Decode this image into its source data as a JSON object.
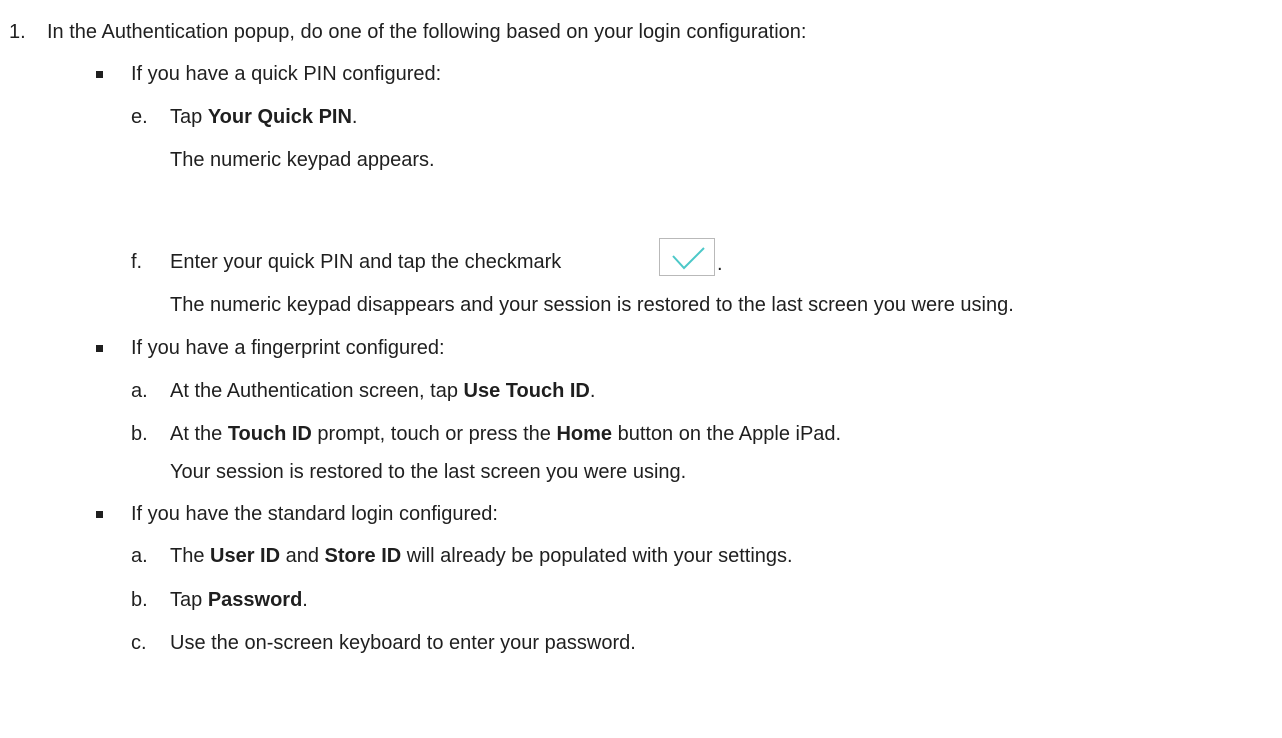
{
  "step": {
    "number": "1.",
    "text": "In the Authentication popup, do one of the following based on your login configuration:"
  },
  "quick_pin": {
    "heading": "If you have a quick PIN configured:",
    "e": {
      "marker": "e.",
      "pre": "Tap ",
      "bold": "Your Quick PIN",
      "post": ".",
      "result": "The numeric keypad appears."
    },
    "f": {
      "marker": "f.",
      "text": "Enter your quick PIN and tap the checkmark",
      "post": ".",
      "icon": "checkmark-icon",
      "result": "The numeric keypad disappears and your session is restored to the last screen you were using."
    }
  },
  "fingerprint": {
    "heading": "If you have a fingerprint configured:",
    "a": {
      "marker": "a.",
      "pre": "At the Authentication screen, tap ",
      "bold": "Use Touch ID",
      "post": "."
    },
    "b": {
      "marker": "b.",
      "pre": "At the ",
      "bold1": "Touch ID",
      "mid": " prompt, touch or press the ",
      "bold2": "Home",
      "post": " button on the Apple iPad.",
      "result": "Your session is restored to the last screen you were using."
    }
  },
  "standard": {
    "heading": "If you have the standard login configured:",
    "a": {
      "marker": "a.",
      "pre": "The ",
      "bold1": "User ID",
      "mid": " and ",
      "bold2": "Store ID",
      "post": " will already be populated with your settings."
    },
    "b": {
      "marker": "b.",
      "pre": "Tap ",
      "bold": "Password",
      "post": "."
    },
    "c": {
      "marker": "c.",
      "text": "Use the on-screen keyboard to enter your password."
    }
  },
  "colors": {
    "text": "#1f1f1f",
    "checkmark": "#4cc8c8",
    "icon_border": "#b9b9b9"
  }
}
